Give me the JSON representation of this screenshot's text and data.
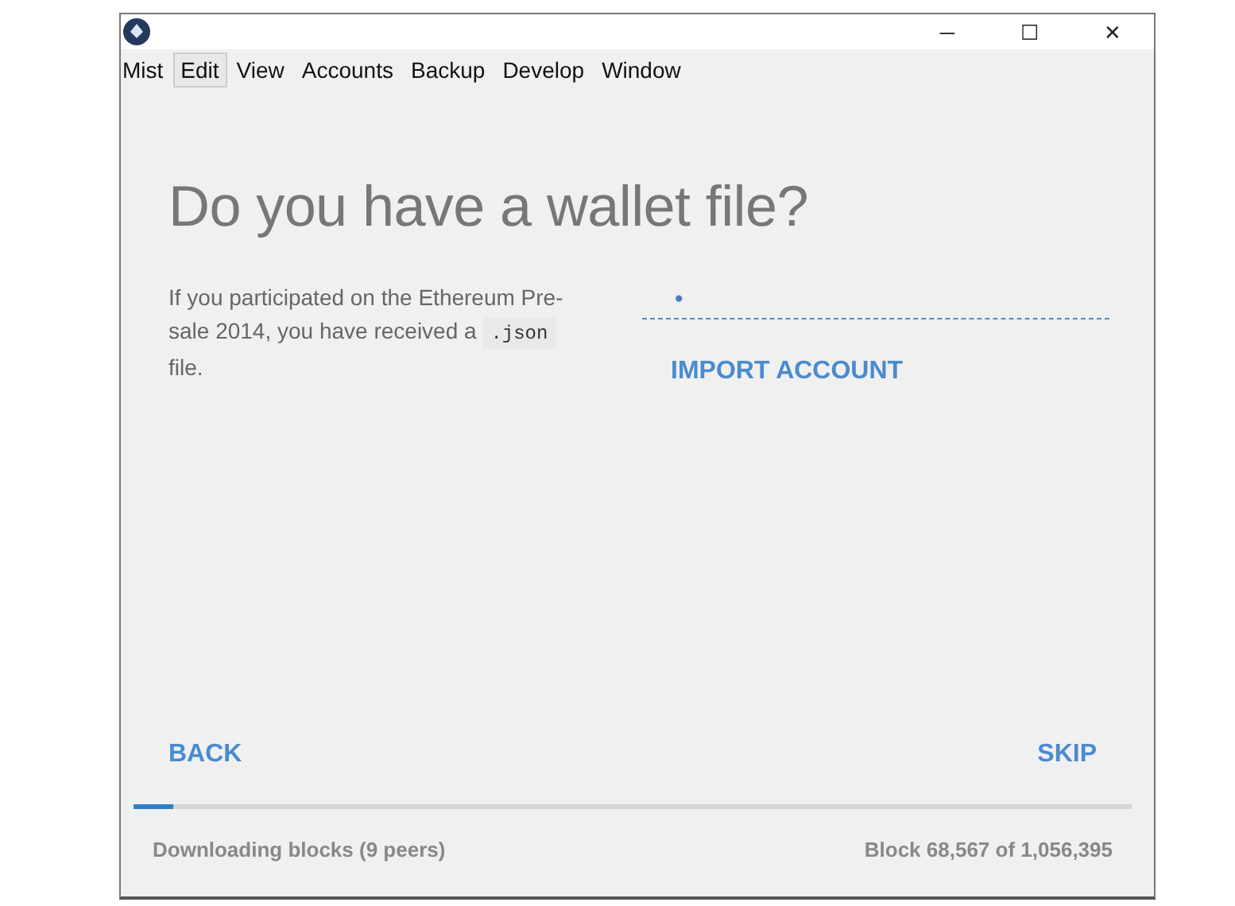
{
  "window": {
    "controls": [
      "─",
      "☐",
      "✕"
    ]
  },
  "menu": [
    {
      "label": "Mist",
      "selected": false
    },
    {
      "label": "Edit",
      "selected": true
    },
    {
      "label": "View",
      "selected": false
    },
    {
      "label": "Accounts",
      "selected": false
    },
    {
      "label": "Backup",
      "selected": false
    },
    {
      "label": "Develop",
      "selected": false
    },
    {
      "label": "Window",
      "selected": false
    }
  ],
  "heading": "Do you have a wallet file?",
  "description": {
    "before": "If you participated on the Ethereum Pre-sale 2014, you have received a",
    "code": ".json",
    "after": "file."
  },
  "password_field": {
    "value": "•"
  },
  "import_button": "IMPORT ACCOUNT",
  "back_button": "BACK",
  "skip_button": "SKIP",
  "progress": {
    "level": 0.04
  },
  "status": {
    "left": "Downloading blocks (9 peers)",
    "right": "Block 68,567 of 1,056,395"
  }
}
